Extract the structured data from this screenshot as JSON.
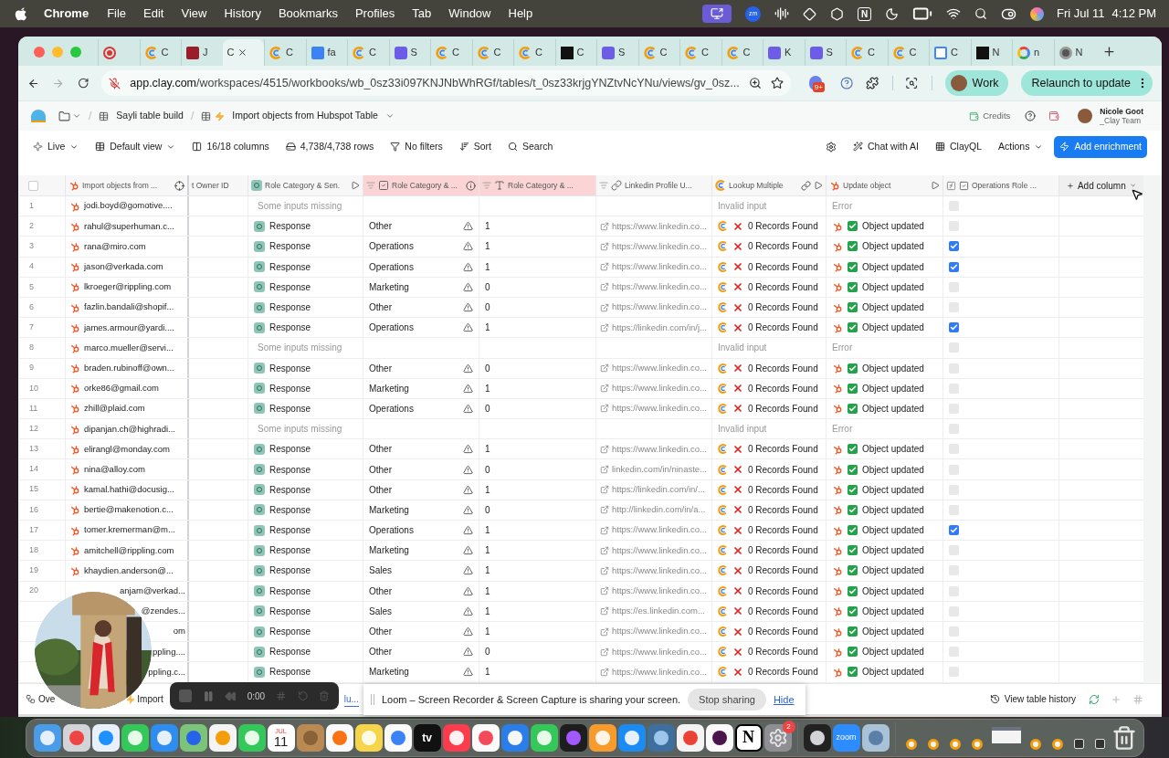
{
  "menubar": {
    "app": "Chrome",
    "items": [
      "File",
      "Edit",
      "View",
      "History",
      "Bookmarks",
      "Profiles",
      "Tab",
      "Window",
      "Help"
    ],
    "status": [
      {
        "kind": "screen"
      },
      {
        "kind": "zm",
        "label": "zm"
      },
      {
        "kind": "bars"
      },
      {
        "kind": "diamond"
      },
      {
        "kind": "shape"
      },
      {
        "kind": "notion",
        "label": "N"
      },
      {
        "kind": "moon"
      },
      {
        "kind": "battery"
      },
      {
        "kind": "wifi"
      },
      {
        "kind": "search"
      },
      {
        "kind": "control"
      },
      {
        "kind": "siri"
      }
    ],
    "date": "Fri Jul 11",
    "time": "4:12 PM"
  },
  "browser": {
    "tabs": [
      {
        "kind": "record",
        "selected": false
      },
      {
        "kind": "clay",
        "title": "C",
        "selected": false
      },
      {
        "kind": "red",
        "title": "J",
        "selected": false
      },
      {
        "kind": "plain",
        "title": "C",
        "selected": true
      },
      {
        "kind": "clay",
        "title": "C",
        "selected": false
      },
      {
        "kind": "blue",
        "title": "fa",
        "selected": false
      },
      {
        "kind": "clay",
        "title": "C",
        "selected": false
      },
      {
        "kind": "s",
        "title": "S",
        "selected": false
      },
      {
        "kind": "clay",
        "title": "C",
        "selected": false
      },
      {
        "kind": "clay",
        "title": "C",
        "selected": false
      },
      {
        "kind": "clay",
        "title": "C",
        "selected": false
      },
      {
        "kind": "dark",
        "title": "C",
        "selected": false
      },
      {
        "kind": "s",
        "title": "S",
        "selected": false
      },
      {
        "kind": "clay",
        "title": "C",
        "selected": false
      },
      {
        "kind": "clay",
        "title": "C",
        "selected": false
      },
      {
        "kind": "clay",
        "title": "C",
        "selected": false
      },
      {
        "kind": "s",
        "title": "K",
        "selected": false
      },
      {
        "kind": "s",
        "title": "S",
        "selected": false
      },
      {
        "kind": "clay",
        "title": "C",
        "selected": false
      },
      {
        "kind": "clay",
        "title": "C",
        "selected": false
      },
      {
        "kind": "calendar",
        "title": "C",
        "selected": false
      },
      {
        "kind": "dark",
        "title": "N",
        "selected": false
      },
      {
        "kind": "google",
        "title": "n",
        "selected": false
      },
      {
        "kind": "chrome",
        "title": "N",
        "selected": false
      }
    ],
    "url_host": "app.clay.com",
    "url_path": "/workspaces/4515/workbooks/wb_0sz33i097KNJNbWhRGf/tables/t_0sz33krjgYNZtvNcYNu/views/gv_0sz...",
    "extension_badge": "9+",
    "profile": "Work",
    "relaunch": "Relaunch to update"
  },
  "header": {
    "separator": "/",
    "breadcrumbs": [
      "Sayli table build",
      "Import objects from Hubspot Table"
    ],
    "credits": "Credits",
    "user_name": "Nicole Goot",
    "user_team": "_Clay Team"
  },
  "toolbar": {
    "view_mode": "Live",
    "view": "Default view",
    "columns": "16/18 columns",
    "rows": "4,738/4,738 rows",
    "filters": "No filters",
    "sort": "Sort",
    "search": "Search",
    "chat": "Chat with AI",
    "clayql": "ClayQL",
    "actions": "Actions",
    "add_enrichment": "Add enrichment"
  },
  "table": {
    "columns": [
      {
        "label": "Import objects from ...",
        "highlighted": false
      },
      {
        "label": "t Owner ID",
        "highlighted": false
      },
      {
        "label": "Role Category & Sen.",
        "highlighted": false
      },
      {
        "label": "Role Category & ...",
        "highlighted": true
      },
      {
        "label": "Role Category & ...",
        "highlighted": true
      },
      {
        "label": "Linkedin Profile U...",
        "highlighted": false
      },
      {
        "label": "Lookup Multiple",
        "highlighted": false
      },
      {
        "label": "Update object",
        "highlighted": false
      },
      {
        "label": "Operations Role ...",
        "highlighted": false
      }
    ],
    "select_all": {
      "checked": false
    },
    "add_column": "Add column",
    "rows": [
      {
        "num": "1",
        "email": "jodi.boyd@gomotive....",
        "kind": "missing",
        "status": "Some inputs missing",
        "lookup": "Invalid input",
        "update": "Error",
        "checked": false
      },
      {
        "num": "2",
        "email": "rahul@superhuman.c...",
        "kind": "ok",
        "status": "Response",
        "category": "Other",
        "value": "1",
        "linkedin": "https://www.linkedin.co...",
        "lookup": "0 Records Found",
        "update": "Object updated",
        "checked": false
      },
      {
        "num": "3",
        "email": "rana@miro.com",
        "kind": "ok",
        "status": "Response",
        "category": "Operations",
        "value": "1",
        "linkedin": "https://www.linkedin.co...",
        "lookup": "0 Records Found",
        "update": "Object updated",
        "checked": true
      },
      {
        "num": "4",
        "email": "jason@verkada.com",
        "kind": "ok",
        "status": "Response",
        "category": "Operations",
        "value": "1",
        "linkedin": "https://www.linkedin.co...",
        "lookup": "0 Records Found",
        "update": "Object updated",
        "checked": true
      },
      {
        "num": "5",
        "email": "lkroeger@rippling.com",
        "kind": "ok",
        "status": "Response",
        "category": "Marketing",
        "value": "0",
        "linkedin": "https://www.linkedin.co...",
        "lookup": "0 Records Found",
        "update": "Object updated",
        "checked": false
      },
      {
        "num": "6",
        "email": "fazlin.bandali@shopif...",
        "kind": "ok",
        "status": "Response",
        "category": "Other",
        "value": "0",
        "linkedin": "https://www.linkedin.co...",
        "lookup": "0 Records Found",
        "update": "Object updated",
        "checked": false
      },
      {
        "num": "7",
        "email": "james.armour@yardi....",
        "kind": "ok",
        "status": "Response",
        "category": "Operations",
        "value": "1",
        "linkedin": "https://linkedin.com/in/j...",
        "lookup": "0 Records Found",
        "update": "Object updated",
        "checked": true
      },
      {
        "num": "8",
        "email": "marco.mueller@servi...",
        "kind": "missing",
        "status": "Some inputs missing",
        "lookup": "Invalid input",
        "update": "Error",
        "checked": false
      },
      {
        "num": "9",
        "email": "braden.rubinoff@own...",
        "kind": "ok",
        "status": "Response",
        "category": "Other",
        "value": "0",
        "linkedin": "https://www.linkedin.co...",
        "lookup": "0 Records Found",
        "update": "Object updated",
        "checked": false
      },
      {
        "num": "10",
        "email": "orke86@gmail.com",
        "kind": "ok",
        "status": "Response",
        "category": "Marketing",
        "value": "1",
        "linkedin": "https://www.linkedin.co...",
        "lookup": "0 Records Found",
        "update": "Object updated",
        "checked": false
      },
      {
        "num": "11",
        "email": "zhill@plaid.com",
        "kind": "ok",
        "status": "Response",
        "category": "Operations",
        "value": "0",
        "linkedin": "https://www.linkedin.co...",
        "lookup": "0 Records Found",
        "update": "Object updated",
        "checked": false
      },
      {
        "num": "12",
        "email": "dipanjan.ch@highradi...",
        "kind": "missing",
        "status": "Some inputs missing",
        "lookup": "Invalid input",
        "update": "Error",
        "checked": false
      },
      {
        "num": "13",
        "email": "elirangl@monday.com",
        "kind": "ok",
        "status": "Response",
        "category": "Other",
        "value": "1",
        "linkedin": "https://www.linkedin.co...",
        "lookup": "0 Records Found",
        "update": "Object updated",
        "checked": false
      },
      {
        "num": "14",
        "email": "nina@alloy.com",
        "kind": "ok",
        "status": "Response",
        "category": "Other",
        "value": "0",
        "linkedin": "linkedin.com/in/ninaste...",
        "lookup": "0 Records Found",
        "update": "Object updated",
        "checked": false
      },
      {
        "num": "15",
        "email": "kamal.hathi@docusig...",
        "kind": "ok",
        "status": "Response",
        "category": "Other",
        "value": "1",
        "linkedin": "https://linkedin.com/in/...",
        "lookup": "0 Records Found",
        "update": "Object updated",
        "checked": false
      },
      {
        "num": "16",
        "email": "bertie@makenotion.c...",
        "kind": "ok",
        "status": "Response",
        "category": "Marketing",
        "value": "0",
        "linkedin": "http://linkedin.com/in/a...",
        "lookup": "0 Records Found",
        "update": "Object updated",
        "checked": false
      },
      {
        "num": "17",
        "email": "tomer.kremerman@m...",
        "kind": "ok",
        "status": "Response",
        "category": "Operations",
        "value": "1",
        "linkedin": "https://www.linkedin.co...",
        "lookup": "0 Records Found",
        "update": "Object updated",
        "checked": true
      },
      {
        "num": "18",
        "email": "amitchell@rippling.com",
        "kind": "ok",
        "status": "Response",
        "category": "Marketing",
        "value": "1",
        "linkedin": "https://www.linkedin.co...",
        "lookup": "0 Records Found",
        "update": "Object updated",
        "checked": false
      },
      {
        "num": "19",
        "email": "khaydien.anderson@...",
        "kind": "ok",
        "status": "Response",
        "category": "Sales",
        "value": "1",
        "linkedin": "https://www.linkedin.co...",
        "lookup": "0 Records Found",
        "update": "Object updated",
        "checked": false
      },
      {
        "num": "20",
        "email": "anjam@verkad...",
        "cut": true,
        "kind": "ok",
        "status": "Response",
        "category": "Other",
        "value": "1",
        "linkedin": "https://www.linkedin.co...",
        "lookup": "0 Records Found",
        "update": "Object updated",
        "checked": false
      },
      {
        "email": "@zendes...",
        "cut": true,
        "kind": "ok",
        "status": "Response",
        "category": "Sales",
        "value": "1",
        "linkedin": "https://es.linkedin.com...",
        "lookup": "0 Records Found",
        "update": "Object updated",
        "checked": false
      },
      {
        "email": "om",
        "cut": true,
        "kind": "ok",
        "status": "Response",
        "category": "Other",
        "value": "1",
        "linkedin": "https://www.linkedin.co...",
        "lookup": "0 Records Found",
        "update": "Object updated",
        "checked": false
      },
      {
        "email": "ppling....",
        "cut": true,
        "kind": "ok",
        "status": "Response",
        "category": "Other",
        "value": "0",
        "linkedin": "https://www.linkedin.co...",
        "lookup": "0 Records Found",
        "update": "Object updated",
        "checked": false
      },
      {
        "email": "ppling.c...",
        "cut": true,
        "kind": "ok",
        "status": "Response",
        "category": "Marketing",
        "value": "1",
        "linkedin": "https://www.linkedin.co...",
        "lookup": "0 Records Found",
        "update": "Object updated",
        "checked": false
      }
    ]
  },
  "footer": {
    "tabs": [
      {
        "label": "Ove",
        "selected": false
      },
      {
        "label": "Import",
        "selected": false
      },
      {
        "label": "lu...",
        "selected": true
      }
    ],
    "history": "View table history"
  },
  "loom_bar": {
    "time": "0:00"
  },
  "loom_notice": {
    "message": "Loom – Screen Recorder & Screen Capture is sharing your screen.",
    "stop": "Stop sharing",
    "hide": "Hide"
  },
  "dock": [
    {
      "kind": "finder"
    },
    {
      "kind": "launchpad"
    },
    {
      "kind": "safari"
    },
    {
      "kind": "messages"
    },
    {
      "kind": "mail"
    },
    {
      "kind": "maps"
    },
    {
      "kind": "photos"
    },
    {
      "kind": "facetime"
    },
    {
      "kind": "calendar",
      "month": "JUL",
      "label": "11"
    },
    {
      "kind": "contacts"
    },
    {
      "kind": "reminders"
    },
    {
      "kind": "notes"
    },
    {
      "kind": "freeform"
    },
    {
      "kind": "tv",
      "label": "tv"
    },
    {
      "kind": "music"
    },
    {
      "kind": "news"
    },
    {
      "kind": "keynote"
    },
    {
      "kind": "numbers"
    },
    {
      "kind": "figma"
    },
    {
      "kind": "pages"
    },
    {
      "kind": "appstore"
    },
    {
      "kind": "xcode"
    },
    {
      "kind": "chrome"
    },
    {
      "kind": "slack"
    },
    {
      "kind": "notion",
      "label": "N"
    },
    {
      "kind": "settings",
      "badge": "2"
    },
    {
      "kind": "sep"
    },
    {
      "kind": "linear"
    },
    {
      "kind": "zoom",
      "label": "zoom"
    },
    {
      "kind": "preview"
    },
    {
      "kind": "sep"
    },
    {
      "kind": "mini"
    },
    {
      "kind": "mini"
    },
    {
      "kind": "mini"
    },
    {
      "kind": "mini"
    },
    {
      "kind": "thumb"
    },
    {
      "kind": "mini"
    },
    {
      "kind": "mini"
    },
    {
      "kind": "minidark"
    },
    {
      "kind": "minidark"
    },
    {
      "kind": "trash"
    }
  ]
}
